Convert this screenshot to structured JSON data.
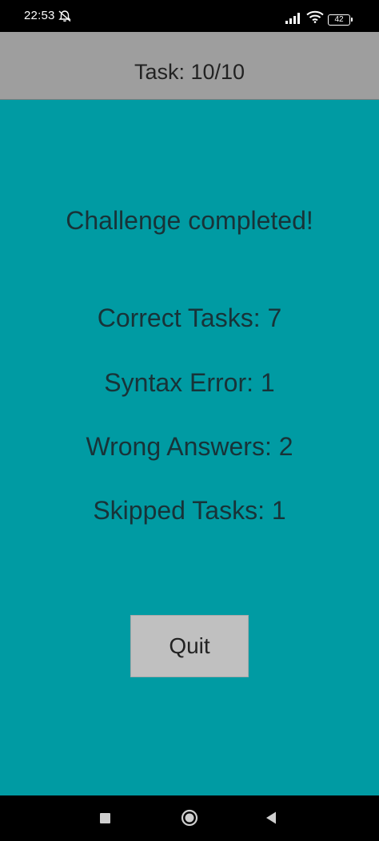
{
  "status_bar": {
    "time": "22:53",
    "battery": "42",
    "icons": [
      "mute-icon",
      "signal-icon",
      "wifi-icon",
      "battery-icon"
    ]
  },
  "header": {
    "title": "Task: 10/10"
  },
  "main": {
    "title": "Challenge completed!",
    "stats": [
      "Correct Tasks: 7",
      "Syntax Error: 1",
      "Wrong Answers: 2",
      "Skipped Tasks: 1"
    ],
    "quit_label": "Quit"
  },
  "nav_bar": {
    "icons": [
      "recents-square-icon",
      "home-circle-icon",
      "back-triangle-icon"
    ]
  },
  "colors": {
    "background": "#009ba3",
    "header": "#9e9e9e",
    "button": "#c0c0c0",
    "text": "#183338"
  }
}
